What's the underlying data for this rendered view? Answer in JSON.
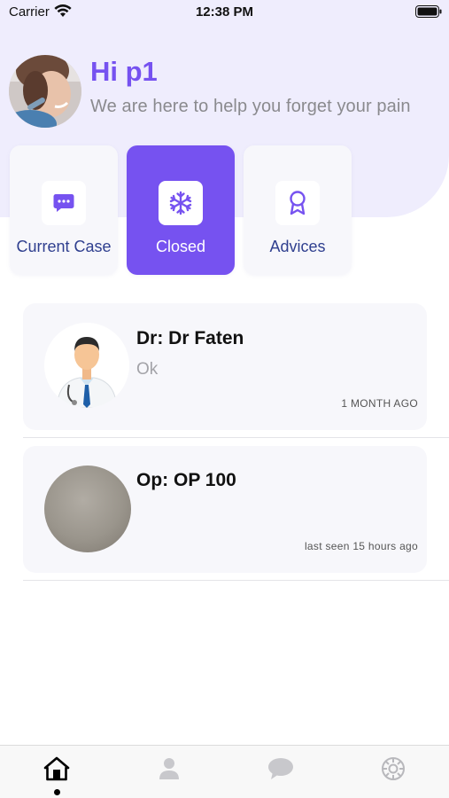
{
  "status_bar": {
    "carrier": "Carrier",
    "time": "12:38 PM"
  },
  "greeting": {
    "title": "Hi p1",
    "subtitle": "We are here to help you forget your pain"
  },
  "categories": [
    {
      "label": "Current Case",
      "icon": "chat-bubble-icon",
      "active": false
    },
    {
      "label": "Closed",
      "icon": "snowflake-icon",
      "active": true
    },
    {
      "label": "Advices",
      "icon": "award-ribbon-icon",
      "active": false
    }
  ],
  "cases": [
    {
      "name": "Dr: Dr Faten",
      "message": "Ok",
      "time": "1 MONTH AGO",
      "avatar": "doctor-avatar"
    },
    {
      "name": "Op: OP 100",
      "message": "",
      "time": "last seen 15 hours ago",
      "avatar": "blurred-avatar"
    }
  ],
  "tabbar": {
    "items": [
      {
        "icon": "home-icon",
        "active": true
      },
      {
        "icon": "profile-icon",
        "active": false
      },
      {
        "icon": "chat-icon",
        "active": false
      },
      {
        "icon": "settings-gear-icon",
        "active": false
      }
    ]
  },
  "colors": {
    "accent": "#7652f0",
    "header_bg": "#efedfd",
    "tile_label": "#2f3f8f",
    "inactive_icon": "#c8c8cc"
  }
}
